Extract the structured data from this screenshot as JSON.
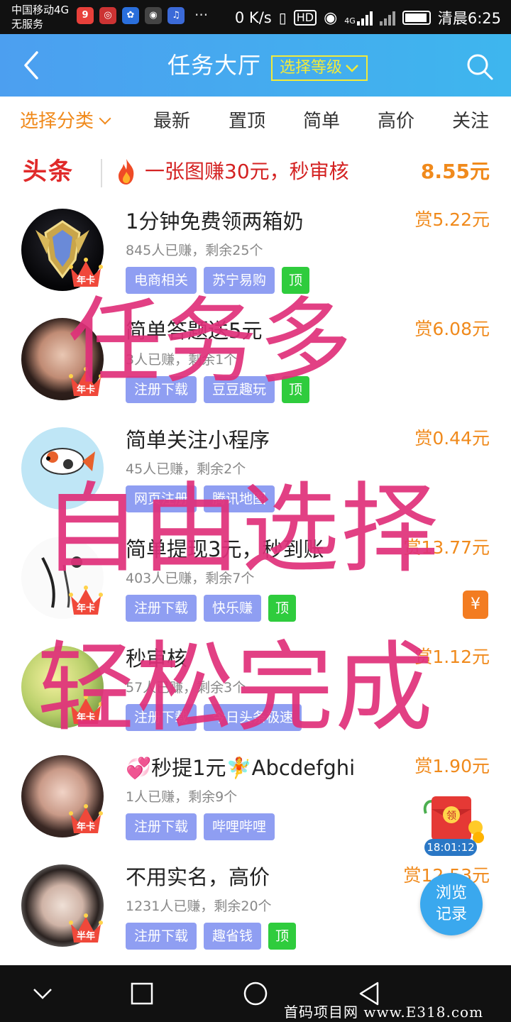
{
  "status_bar": {
    "carrier": "中国移动4G",
    "carrier_sub": "无服务",
    "speed": "0 K/s",
    "hd": "HD",
    "net": "4G",
    "time": "清晨6:25"
  },
  "header": {
    "title": "任务大厅",
    "level_button": "选择等级"
  },
  "tabs": [
    {
      "label": "选择分类",
      "active": true
    },
    {
      "label": "最新",
      "active": false
    },
    {
      "label": "置顶",
      "active": false
    },
    {
      "label": "简单",
      "active": false
    },
    {
      "label": "高价",
      "active": false
    },
    {
      "label": "关注",
      "active": false
    }
  ],
  "headline": {
    "logo": "头条",
    "text": "一张图赚30元，秒审核",
    "price": "8.55元"
  },
  "tasks": [
    {
      "title": "1分钟免费领两箱奶",
      "reward": "赏5.22元",
      "stats": "845人已赚，剩余25个",
      "tags": [
        "电商相关",
        "苏宁易购"
      ],
      "top": "顶",
      "badge": "年卡"
    },
    {
      "title": "简单答题送5元",
      "reward": "赏6.08元",
      "stats": "3人已赚，剩余1个",
      "tags": [
        "注册下载",
        "豆豆趣玩"
      ],
      "top": "顶",
      "badge": "年卡"
    },
    {
      "title": "简单关注小程序",
      "reward": "赏0.44元",
      "stats": "45人已赚，剩余2个",
      "tags": [
        "网页注册",
        "腾讯地图"
      ],
      "top": "",
      "badge": ""
    },
    {
      "title": "简单提现3元，秒到账",
      "reward": "赏13.77元",
      "stats": "403人已赚，剩余7个",
      "tags": [
        "注册下载",
        "快乐赚"
      ],
      "top": "顶",
      "badge": "年卡"
    },
    {
      "title": "秒审核",
      "reward": "赏1.12元",
      "stats": "57人已赚，剩余3个",
      "tags": [
        "注册下载",
        "今日头条极速"
      ],
      "top": "",
      "badge": "年卡"
    },
    {
      "title": "💞秒提1元🧚Abcdefghi",
      "reward": "赏1.90元",
      "stats": "1人已赚，剩余9个",
      "tags": [
        "注册下载",
        "哔哩哔哩"
      ],
      "top": "",
      "badge": "年卡"
    },
    {
      "title": "不用实名，高价",
      "reward": "赏12.53元",
      "stats": "1231人已赚，剩余20个",
      "tags": [
        "注册下载",
        "趣省钱"
      ],
      "top": "顶",
      "badge": "半年"
    }
  ],
  "promo": {
    "line1": "任务多",
    "line2": "自由选择",
    "line3": "轻松完成"
  },
  "floats": {
    "yuan": "¥",
    "redpacket_label": "领",
    "timer": "18:01:12",
    "history_line1": "浏览",
    "history_line2": "记录"
  },
  "watermark": "首码项目网 www.E318.com",
  "colors": {
    "accent": "#f08a1c",
    "header": "#3eb6ee",
    "tag": "#8f9ef2",
    "top_tag": "#2fcc3d",
    "promo": "#e0307a"
  }
}
